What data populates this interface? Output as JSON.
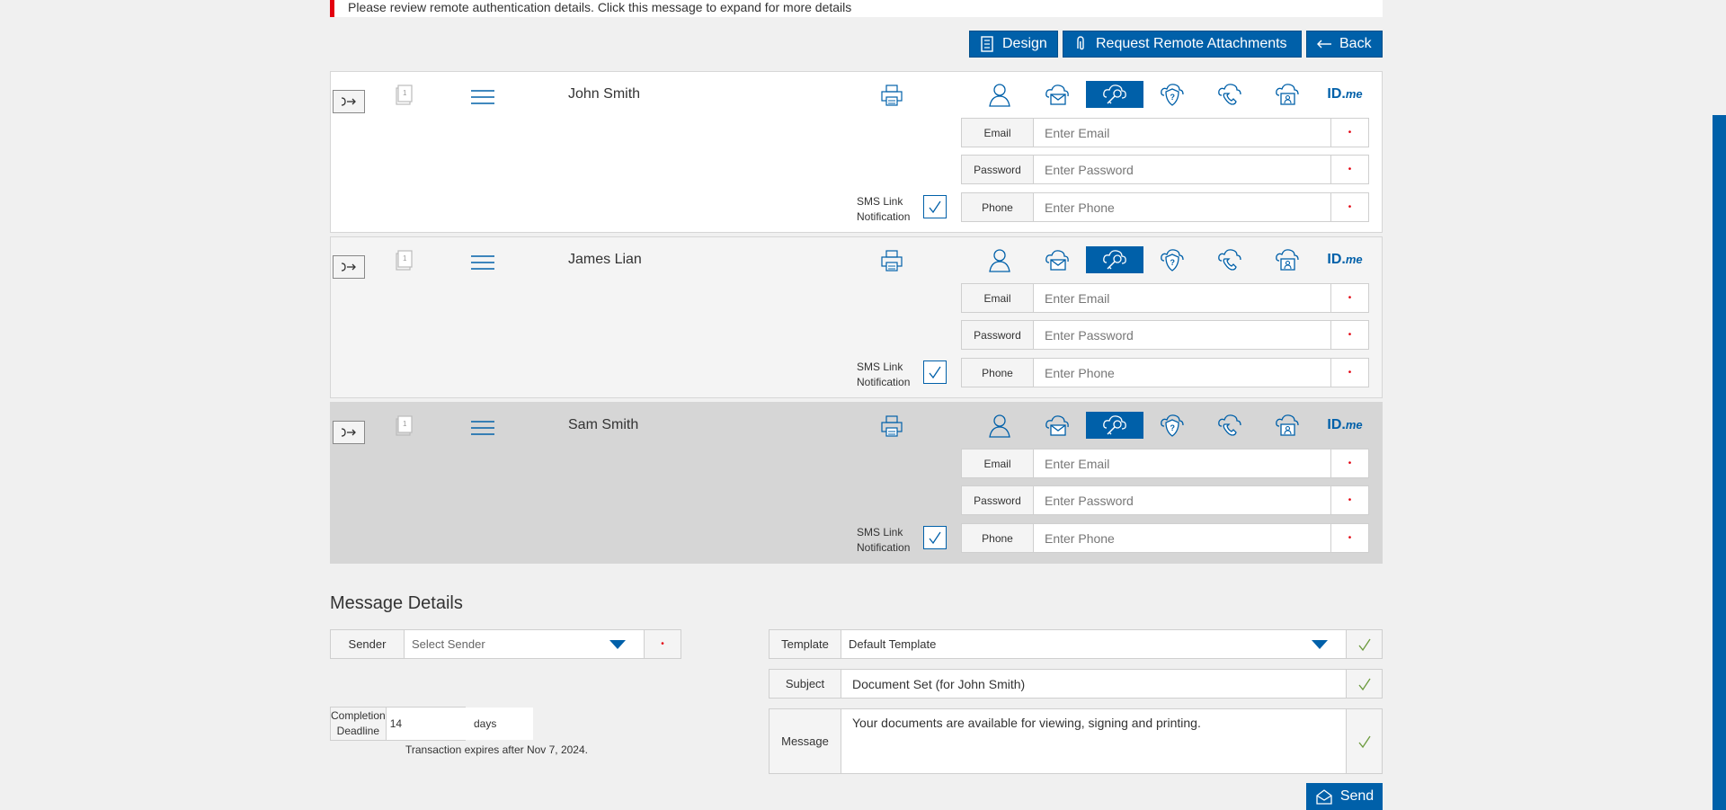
{
  "notice": {
    "text": "Please review remote authentication details. Click this message to expand for more details"
  },
  "toolbar": {
    "design_label": "Design",
    "request_label": "Request Remote Attachments",
    "back_label": "Back"
  },
  "recipients": [
    {
      "name": "John Smith",
      "email_label": "Email",
      "email_placeholder": "Enter Email",
      "password_label": "Password",
      "password_placeholder": "Enter Password",
      "phone_label": "Phone",
      "phone_placeholder": "Enter Phone",
      "sms_label_1": "SMS Link",
      "sms_label_2": "Notification",
      "bg": "#ffffff"
    },
    {
      "name": "James Lian",
      "email_label": "Email",
      "email_placeholder": "Enter Email",
      "password_label": "Password",
      "password_placeholder": "Enter Password",
      "phone_label": "Phone",
      "phone_placeholder": "Enter Phone",
      "sms_label_1": "SMS Link",
      "sms_label_2": "Notification",
      "bg": "#f4f4f4"
    },
    {
      "name": "Sam Smith",
      "email_label": "Email",
      "email_placeholder": "Enter Email",
      "password_label": "Password",
      "password_placeholder": "Enter Password",
      "phone_label": "Phone",
      "phone_placeholder": "Enter Phone",
      "sms_label_1": "SMS Link",
      "sms_label_2": "Notification",
      "bg": "#d6d6d6"
    }
  ],
  "auth_icons": [
    "person-icon",
    "cloud-email-icon",
    "cloud-key-icon",
    "shield-question-icon",
    "cloud-phone-icon",
    "cloud-id-card-icon",
    "idme-logo"
  ],
  "idme": {
    "text": "ID.",
    "suffix": "me"
  },
  "message_details": {
    "title": "Message Details",
    "sender_label": "Sender",
    "sender_value": "Select Sender",
    "deadline_label_1": "Completion",
    "deadline_label_2": "Deadline",
    "deadline_value": "14",
    "deadline_unit": "days",
    "expires_text": "Transaction expires after Nov 7, 2024.",
    "template_label": "Template",
    "template_value": "Default Template",
    "subject_label": "Subject",
    "subject_value": "Document Set (for John Smith)",
    "message_label": "Message",
    "message_value": "Your documents are available for viewing, signing and printing.",
    "send_label": "Send"
  },
  "colors": {
    "accent": "#0060a9",
    "required": "#e3000f",
    "notice_bar": "#e3000f"
  }
}
